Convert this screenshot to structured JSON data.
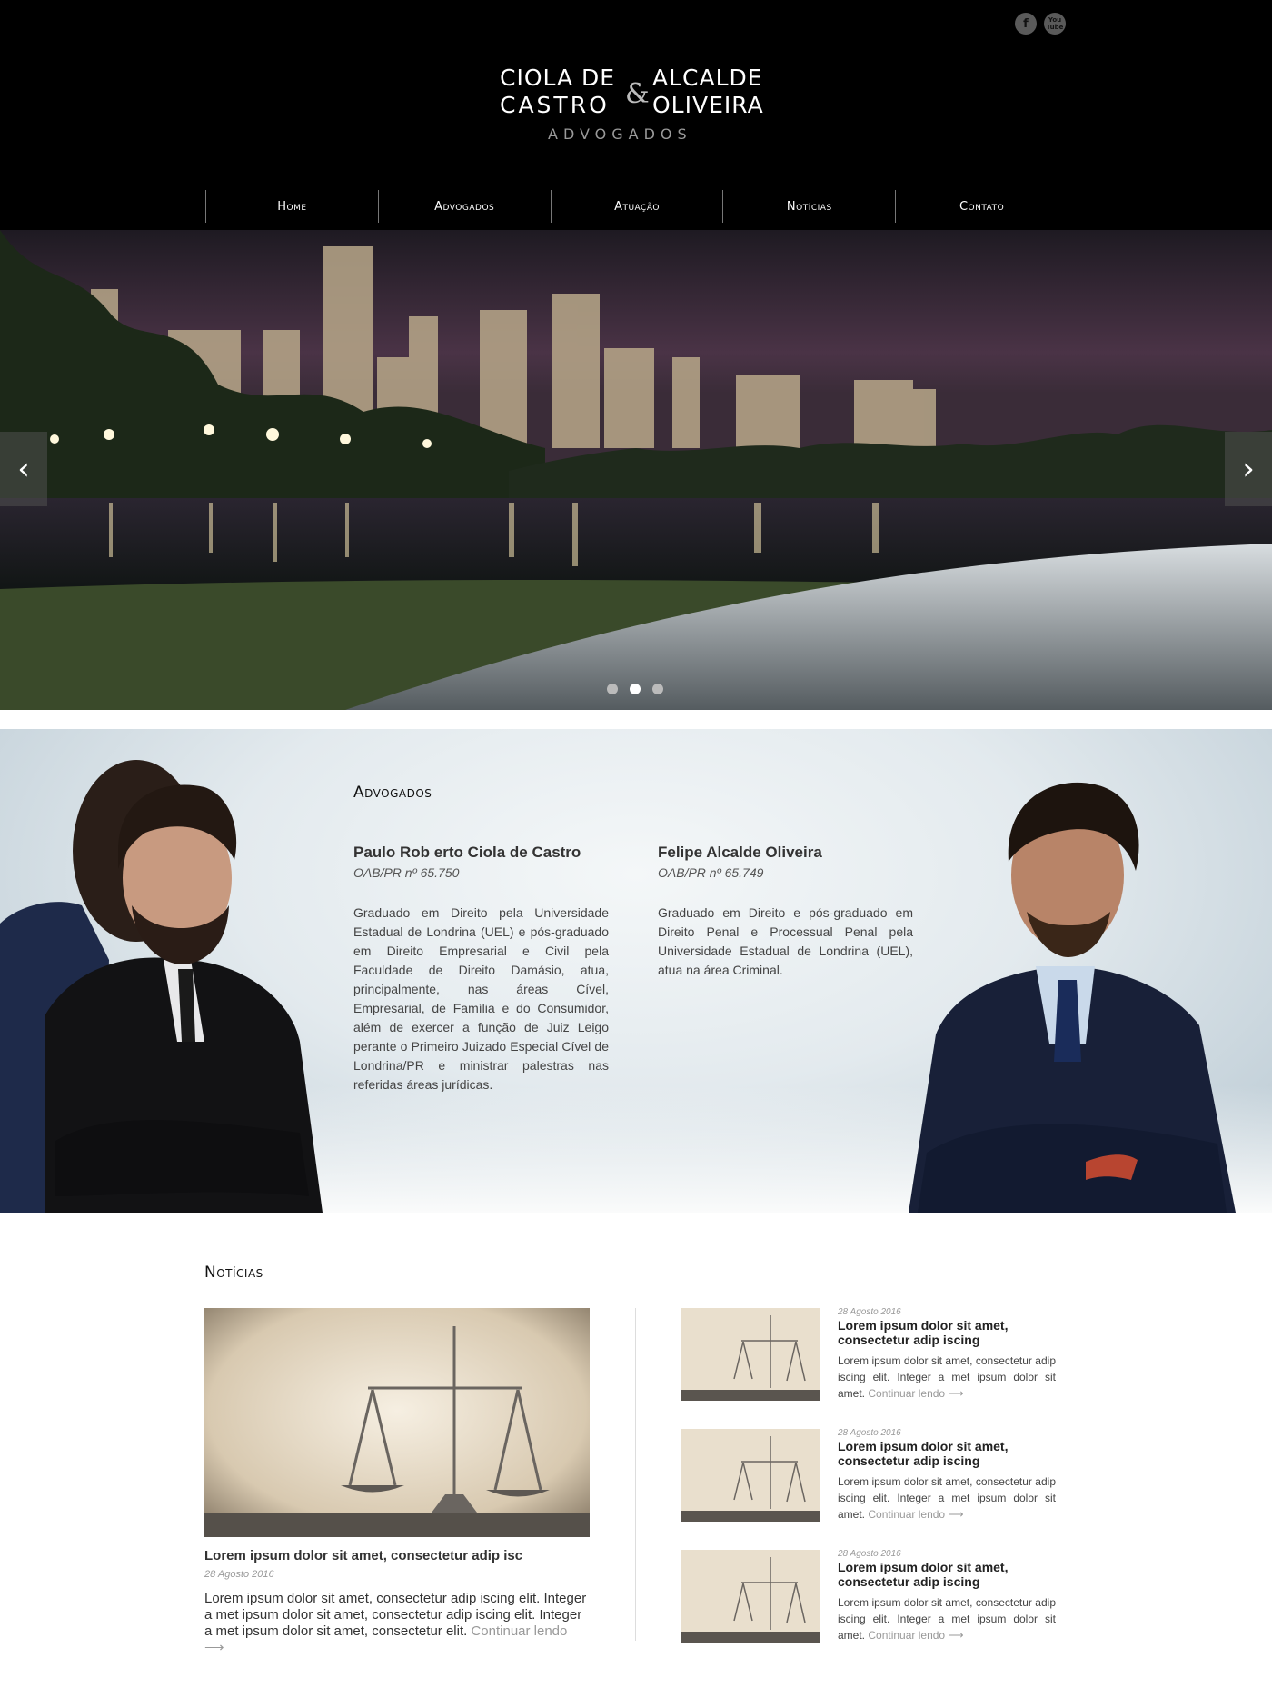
{
  "header": {
    "social": [
      {
        "icon": "facebook-icon",
        "glyph": "f"
      },
      {
        "icon": "youtube-icon",
        "glyph": "You Tube"
      }
    ],
    "logo": {
      "left_line1": "CIOLA DE",
      "left_line2": "CASTRO",
      "ampersand": "&",
      "right_line1": "ALCALDE",
      "right_line2": "OLIVEIRA",
      "subtitle": "ADVOGADOS"
    },
    "nav": [
      "Home",
      "Advogados",
      "Atuação",
      "Notícias",
      "Contato"
    ]
  },
  "hero": {
    "prev_glyph": "‹",
    "next_glyph": "›",
    "slides_count": 3,
    "active_slide": 2
  },
  "lawyers": {
    "title": "Advogados",
    "people": [
      {
        "name": "Paulo Rob erto Ciola de Castro",
        "oab": "OAB/PR nº 65.750",
        "bio": "Graduado em Direito pela Universidade Estadual de Londrina (UEL) e pós-graduado em Direito Empresarial e Civil pela Faculdade de Direito Damásio, atua, principalmente, nas áreas Cível, Empresarial, de Família e do Consumidor, além de exercer a função de Juiz Leigo perante o Primeiro Juizado Especial Cível de Londrina/PR e ministrar palestras nas referidas áreas jurídicas."
      },
      {
        "name": "Felipe Alcalde Oliveira",
        "oab": "OAB/PR nº 65.749",
        "bio": "Graduado em Direito e pós-graduado em Direito Penal e Processual Penal pela Universidade Estadual de Londrina (UEL), atua na área Criminal."
      }
    ]
  },
  "news": {
    "title": "Notícias",
    "featured": {
      "title": "Lorem ipsum dolor sit amet, consectetur adip isc",
      "date": "28 Agosto 2016",
      "excerpt": "Lorem ipsum dolor sit amet, consectetur adip iscing elit. Integer a met  ipsum dolor sit amet, consectetur adip iscing elit. Integer a met  ipsum dolor sit amet, consectetur elit. ",
      "more": "Continuar lendo ⟶"
    },
    "items": [
      {
        "date": "28 Agosto 2016",
        "title": "Lorem ipsum dolor sit amet, consectetur adip iscing",
        "excerpt": "Lorem ipsum dolor sit amet, consectetur adip iscing elit. Integer a met  ipsum dolor sit amet. ",
        "more": "Continuar lendo ⟶"
      },
      {
        "date": "28 Agosto 2016",
        "title": "Lorem ipsum dolor sit amet, consectetur adip iscing",
        "excerpt": "Lorem ipsum dolor sit amet, consectetur adip iscing elit. Integer a met  ipsum dolor sit amet. ",
        "more": "Continuar lendo ⟶"
      },
      {
        "date": "28 Agosto 2016",
        "title": "Lorem ipsum dolor sit amet, consectetur adip iscing",
        "excerpt": "Lorem ipsum dolor sit amet, consectetur adip iscing elit. Integer a met  ipsum dolor sit amet. ",
        "more": "Continuar lendo ⟶"
      }
    ]
  }
}
